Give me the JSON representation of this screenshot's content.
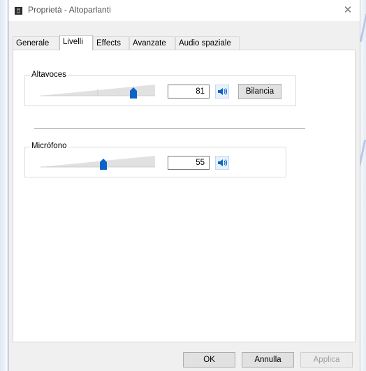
{
  "window": {
    "title": "Proprietà - Altoparlanti",
    "close_glyph": "✕"
  },
  "tabs": [
    {
      "label": "Generale",
      "active": false
    },
    {
      "label": "Livelli",
      "active": true
    },
    {
      "label": "Effects",
      "active": false
    },
    {
      "label": "Avanzate",
      "active": false
    },
    {
      "label": "Audio spaziale",
      "active": false
    }
  ],
  "levels": {
    "speakers": {
      "label": "Altavoces",
      "value": "81",
      "level_fraction": 0.81,
      "mute_icon": "speaker-icon",
      "balance_label": "Bilancia"
    },
    "microphone": {
      "label": "Micrófono",
      "value": "55",
      "level_fraction": 0.55,
      "mute_icon": "speaker-icon"
    }
  },
  "buttons": {
    "ok": "OK",
    "cancel": "Annulla",
    "apply": "Applica"
  },
  "colors": {
    "accent": "#0a64c8",
    "track": "#e1e1e1"
  }
}
